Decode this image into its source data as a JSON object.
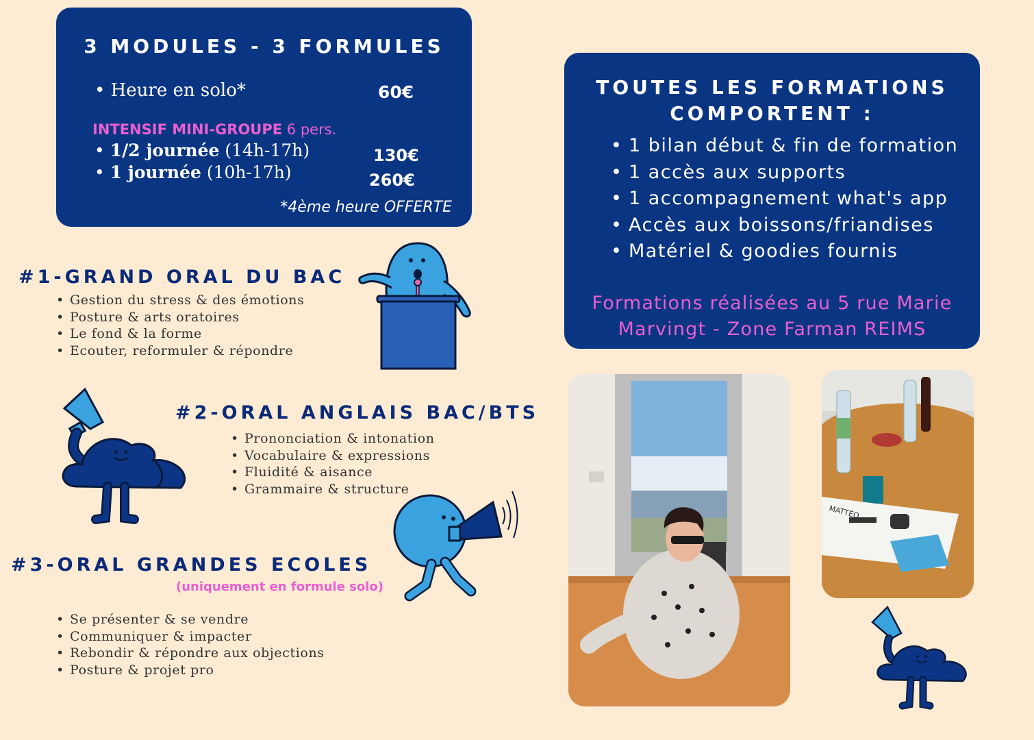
{
  "pricing": {
    "title": "3 MODULES - 3 FORMULES",
    "solo_label": "Heure en solo*",
    "solo_price": "60€",
    "group_label": "INTENSIF MINI-GROUPE",
    "group_size": "6 pers.",
    "half_day_label": "1/2 journée",
    "half_day_hours": "(14h-17h)",
    "half_day_price": "130€",
    "full_day_label": "1 journée",
    "full_day_hours": "(10h-17h)",
    "full_day_price": "260€",
    "note": "*4ème heure OFFERTE"
  },
  "features": {
    "title_line1": "TOUTES LES FORMATIONS",
    "title_line2": "COMPORTENT :",
    "items": [
      "1 bilan début & fin de formation",
      "1 accès aux supports",
      "1 accompagnement what's app",
      "Accès aux boissons/friandises",
      "Matériel & goodies fournis"
    ],
    "location_line1": "Formations réalisées au 5 rue Marie",
    "location_line2": "Marvingt - Zone Farman REIMS"
  },
  "modules": [
    {
      "title": "#1-GRAND ORAL DU BAC",
      "items": [
        "Gestion du stress & des émotions",
        "Posture & arts oratoires",
        "Le fond & la forme",
        "Ecouter, reformuler & répondre"
      ]
    },
    {
      "title": "#2-ORAL ANGLAIS BAC/BTS",
      "items": [
        "Prononciation & intonation",
        "Vocabulaire & expressions",
        "Fluidité & aisance",
        "Grammaire & structure"
      ]
    },
    {
      "title": "#3-ORAL GRANDES ECOLES",
      "subtitle": "(uniquement en formule solo)",
      "items": [
        "Se présenter & se vendre",
        "Communiquer & impacter",
        "Rebondir & répondre aux objections",
        "Posture & projet pro"
      ]
    }
  ],
  "photo2_card_text": "MATTÉO",
  "colors": {
    "background": "#fdebd3",
    "card": "#0a3583",
    "accent_pink": "#ea5fcf",
    "title_blue": "#0b2b78",
    "mascot_dark": "#0d3585",
    "mascot_light": "#3aa2df"
  }
}
